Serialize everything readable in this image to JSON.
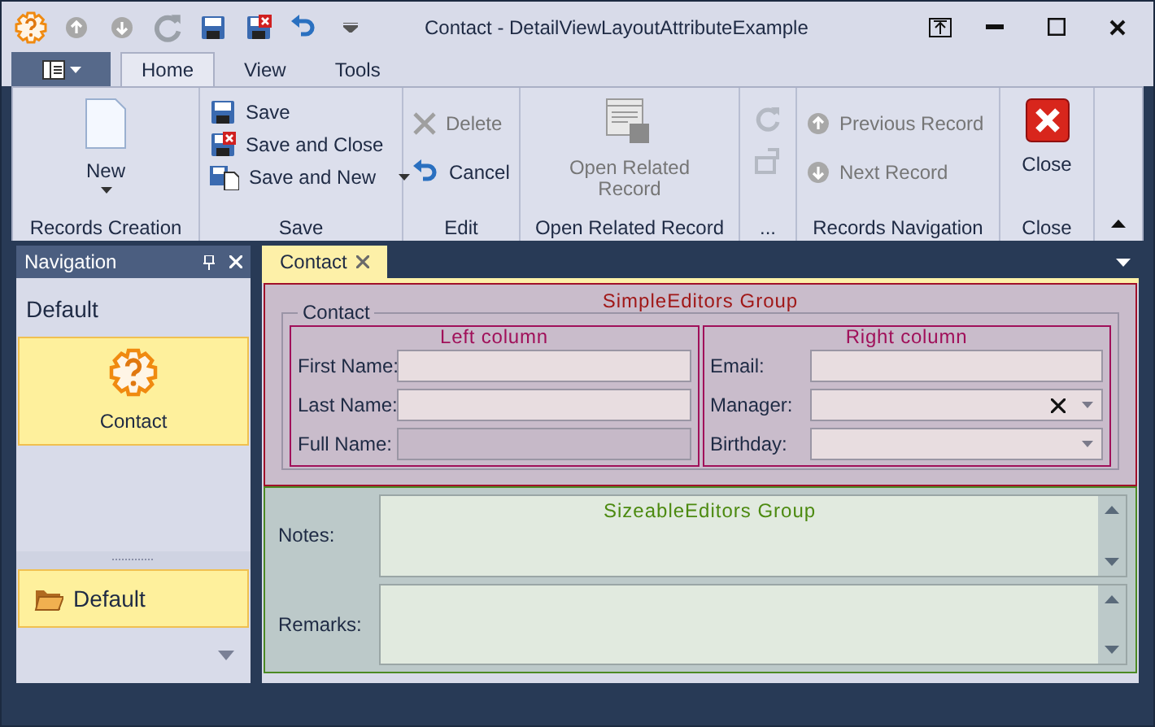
{
  "window": {
    "title": "Contact - DetailViewLayoutAttributeExample"
  },
  "ribbon": {
    "tabs": [
      {
        "label": "Home",
        "selected": true
      },
      {
        "label": "View",
        "selected": false
      },
      {
        "label": "Tools",
        "selected": false
      }
    ],
    "groups": [
      {
        "title": "Records Creation",
        "items": [
          {
            "kind": "large",
            "label": "New",
            "dropdown": true,
            "disabled": false
          }
        ]
      },
      {
        "title": "Save",
        "items": [
          {
            "kind": "small",
            "label": "Save",
            "dropdown": false,
            "disabled": false
          },
          {
            "kind": "small",
            "label": "Save and Close",
            "dropdown": false,
            "disabled": false
          },
          {
            "kind": "small",
            "label": "Save and New",
            "dropdown": true,
            "disabled": false
          }
        ]
      },
      {
        "title": "Edit",
        "items": [
          {
            "kind": "small",
            "label": "Delete",
            "dropdown": false,
            "disabled": true
          },
          {
            "kind": "small",
            "label": "Cancel",
            "dropdown": false,
            "disabled": false
          }
        ]
      },
      {
        "title": "Open Related Record",
        "items": [
          {
            "kind": "large",
            "label": "Open Related Record",
            "dropdown": false,
            "disabled": true
          }
        ]
      },
      {
        "title": "...",
        "items": [
          {
            "kind": "icon",
            "disabled": true
          },
          {
            "kind": "icon",
            "disabled": true
          }
        ]
      },
      {
        "title": "Records Navigation",
        "items": [
          {
            "kind": "small",
            "label": "Previous Record",
            "dropdown": false,
            "disabled": true
          },
          {
            "kind": "small",
            "label": "Next Record",
            "dropdown": false,
            "disabled": true
          }
        ]
      },
      {
        "title": "Close",
        "items": [
          {
            "kind": "large",
            "label": "Close",
            "dropdown": false,
            "disabled": false
          }
        ]
      }
    ]
  },
  "navigation": {
    "title": "Navigation",
    "group_title": "Default",
    "items": [
      {
        "label": "Contact",
        "selected": true
      }
    ],
    "groups": [
      {
        "label": "Default",
        "selected": true
      }
    ]
  },
  "document_tabs": [
    {
      "label": "Contact",
      "selected": true
    }
  ],
  "simple_group": {
    "title": "SimpleEditors Group",
    "fieldset": "Contact",
    "columns": [
      {
        "title": "Left column",
        "fields": [
          {
            "label": "First Name:",
            "kind": "text",
            "disabled": false
          },
          {
            "label": "Last Name:",
            "kind": "text",
            "disabled": false
          },
          {
            "label": "Full Name:",
            "kind": "text",
            "disabled": true
          }
        ]
      },
      {
        "title": "Right column",
        "fields": [
          {
            "label": "Email:",
            "kind": "text",
            "disabled": false
          },
          {
            "label": "Manager:",
            "kind": "lookup",
            "disabled": false
          },
          {
            "label": "Birthday:",
            "kind": "date",
            "disabled": false
          }
        ]
      }
    ]
  },
  "sizeable_group": {
    "title": "SizeableEditors Group",
    "fields": [
      {
        "label": "Notes:"
      },
      {
        "label": "Remarks:"
      }
    ]
  }
}
